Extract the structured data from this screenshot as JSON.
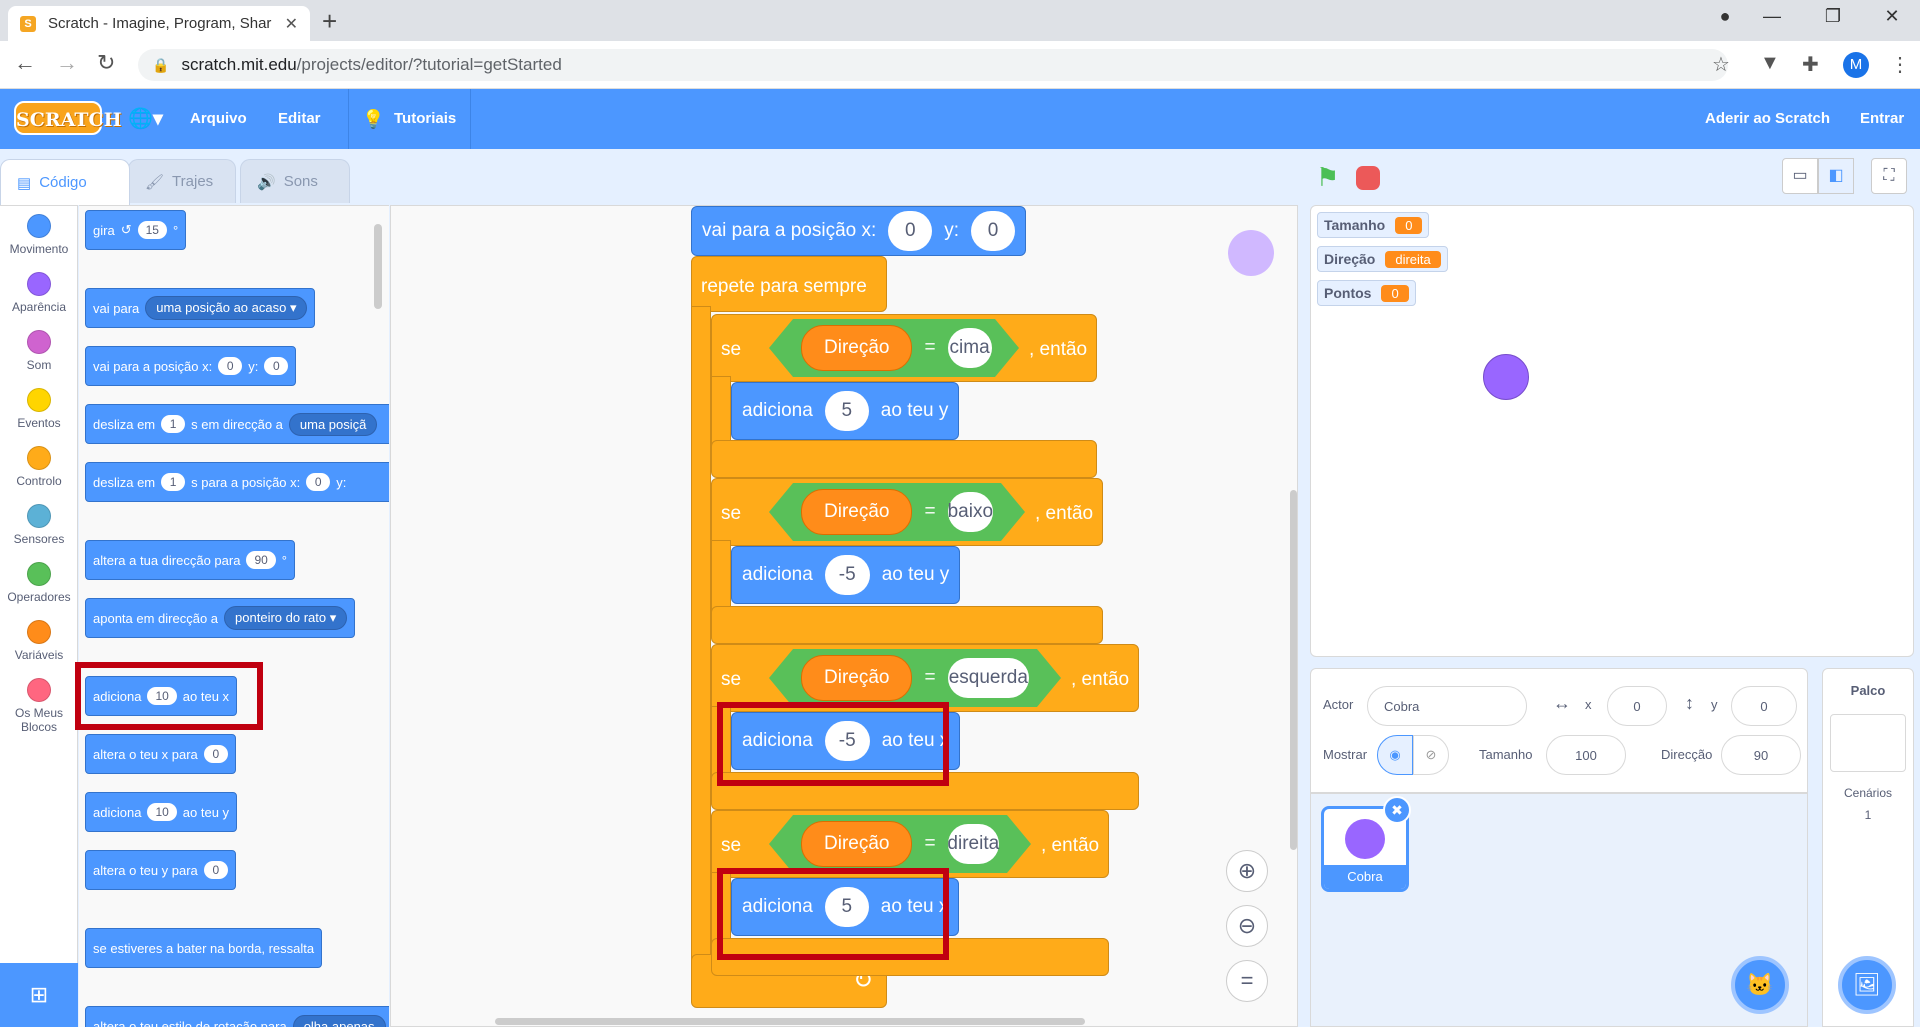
{
  "browser": {
    "tab_title": "Scratch - Imagine, Program, Shar",
    "tab_favicon": "S",
    "url_host": "scratch.mit.edu",
    "url_path": "/projects/editor/?tutorial=getStarted",
    "profile_initial": "M"
  },
  "menu": {
    "logo": "SCRATCH",
    "file": "Arquivo",
    "edit": "Editar",
    "tutorials": "Tutoriais",
    "join": "Aderir ao Scratch",
    "signin": "Entrar"
  },
  "tabs": {
    "code": "Código",
    "costumes": "Trajes",
    "sounds": "Sons"
  },
  "categories": [
    {
      "label": "Movimento",
      "color": "#4c97ff"
    },
    {
      "label": "Aparência",
      "color": "#9966ff"
    },
    {
      "label": "Som",
      "color": "#cf63cf"
    },
    {
      "label": "Eventos",
      "color": "#ffd500"
    },
    {
      "label": "Controlo",
      "color": "#ffab19"
    },
    {
      "label": "Sensores",
      "color": "#5cb1d6"
    },
    {
      "label": "Operadores",
      "color": "#59c059"
    },
    {
      "label": "Variáveis",
      "color": "#ff8c1a"
    },
    {
      "label": "Os Meus Blocos",
      "color": "#ff6680"
    }
  ],
  "palette": {
    "turn": {
      "label": "gira",
      "value": "15",
      "unit": "°"
    },
    "goto": {
      "label": "vai para",
      "menu": "uma posição ao acaso"
    },
    "gotoxy": {
      "label": "vai para a posição x:",
      "x": "0",
      "ylabel": "y:",
      "y": "0"
    },
    "glide1": {
      "label1": "desliza em",
      "value": "1",
      "label2": "s em direcção a",
      "menu": "uma posiçã"
    },
    "glide2": {
      "label1": "desliza em",
      "value": "1",
      "label2": "s para a posição x:",
      "x": "0",
      "ylabel": "y:"
    },
    "pointdir": {
      "label": "altera a tua direcção para",
      "value": "90",
      "unit": "°"
    },
    "pointto": {
      "label": "aponta em direcção a",
      "menu": "ponteiro do rato"
    },
    "changex": {
      "label1": "adiciona",
      "value": "10",
      "label2": "ao teu x"
    },
    "setx": {
      "label": "altera o teu x para",
      "value": "0"
    },
    "changey": {
      "label1": "adiciona",
      "value": "10",
      "label2": "ao teu y"
    },
    "sety": {
      "label": "altera o teu y para",
      "value": "0"
    },
    "bounce": {
      "label": "se estiveres a bater na borda, ressalta"
    },
    "rotstyle": {
      "label": "altera o teu estilo de rotação para",
      "menu": "olha apenas"
    }
  },
  "script": {
    "gotoxy": {
      "label": "vai para a posição x:",
      "x": "0",
      "ylabel": "y:",
      "y": "0"
    },
    "forever": "repete para sempre",
    "ifs": [
      {
        "if": "se",
        "var": "Direção",
        "eq": "=",
        "value": "cima",
        "then": ", então",
        "action": "adiciona",
        "amount": "5",
        "target": "ao teu y"
      },
      {
        "if": "se",
        "var": "Direção",
        "eq": "=",
        "value": "baixo",
        "then": ", então",
        "action": "adiciona",
        "amount": "-5",
        "target": "ao teu y"
      },
      {
        "if": "se",
        "var": "Direção",
        "eq": "=",
        "value": "esquerda",
        "then": ", então",
        "action": "adiciona",
        "amount": "-5",
        "target": "ao teu x"
      },
      {
        "if": "se",
        "var": "Direção",
        "eq": "=",
        "value": "direita",
        "then": ", então",
        "action": "adiciona",
        "amount": "5",
        "target": "ao teu x"
      }
    ],
    "loop_arrow": "↻"
  },
  "stage": {
    "monitors": [
      {
        "name": "Tamanho",
        "value": "0"
      },
      {
        "name": "Direção",
        "value": "direita"
      },
      {
        "name": "Pontos",
        "value": "0"
      }
    ]
  },
  "sprite_info": {
    "actor_label": "Actor",
    "actor_name": "Cobra",
    "x_label": "x",
    "x": "0",
    "y_label": "y",
    "y": "0",
    "show_label": "Mostrar",
    "size_label": "Tamanho",
    "size": "100",
    "dir_label": "Direcção",
    "dir": "90"
  },
  "sprites": [
    {
      "name": "Cobra"
    }
  ],
  "stage_panel": {
    "title": "Palco",
    "backdrops_label": "Cenários",
    "backdrops_count": "1"
  }
}
